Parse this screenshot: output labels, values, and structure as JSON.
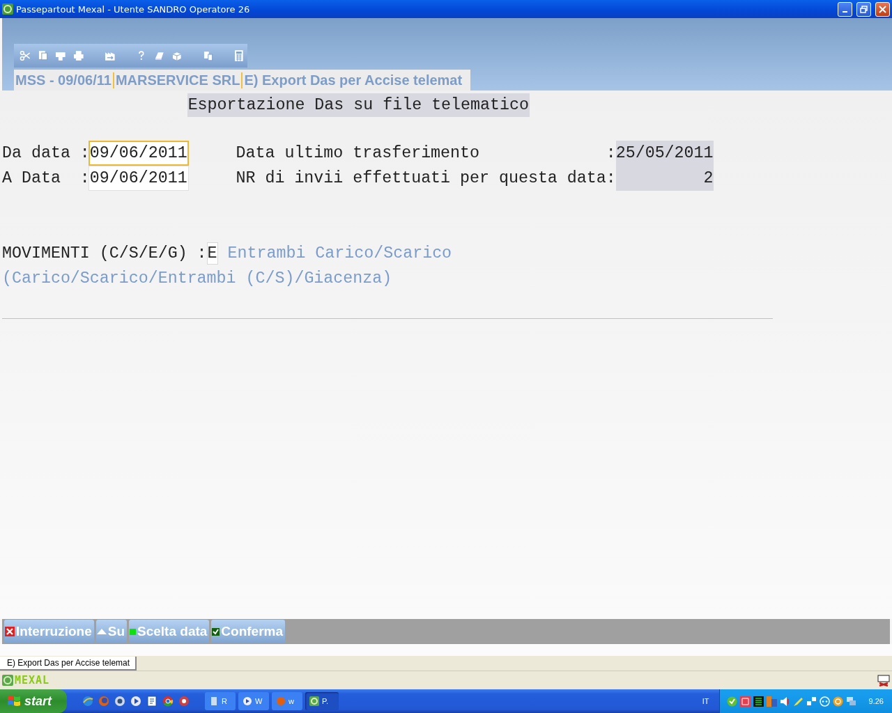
{
  "window": {
    "title": "Passepartout Mexal - Utente SANDRO Operatore 26"
  },
  "header_tabs": [
    "MSS - 09/06/11",
    "MARSERVICE SRL",
    "E) Export Das per Accise telemat"
  ],
  "form": {
    "title": "Esportazione Das su file telematico",
    "date_fields": [
      {
        "label": "Da data :",
        "value": "09/06/2011",
        "focused": true
      },
      {
        "label": "A Data  :",
        "value": "09/06/2011",
        "focused": false
      }
    ],
    "info": [
      {
        "label": "Data ultimo trasferimento",
        "colon": ":",
        "value": "25/05/2011"
      },
      {
        "label": "NR di invii effettuati per questa data:",
        "value": "2"
      }
    ],
    "movimenti": {
      "label": "MOVIMENTI (C/S/E/G) :",
      "value": "E",
      "description": "Entrambi Carico/Scarico",
      "hint": "(Carico/Scarico/Entrambi (C/S)/Giacenza)"
    }
  },
  "function_keys": [
    {
      "kind": "cancel",
      "label": "Interruzione"
    },
    {
      "kind": "up",
      "label": "Su"
    },
    {
      "kind": "dot",
      "label": "Scelta data"
    },
    {
      "kind": "check",
      "label": "Conferma"
    }
  ],
  "open_windows": [
    {
      "label": "E) Export Das per Accise telemat",
      "selected": true
    }
  ],
  "status_bar": {
    "app_name": "MEXAL"
  },
  "taskbar": {
    "start": "start",
    "tasks": [
      {
        "label": "R",
        "selected": false
      },
      {
        "label": "W",
        "selected": false
      },
      {
        "label": "w",
        "selected": false
      },
      {
        "label": "P.",
        "selected": true
      }
    ],
    "language": "IT",
    "clock": "9.26"
  }
}
